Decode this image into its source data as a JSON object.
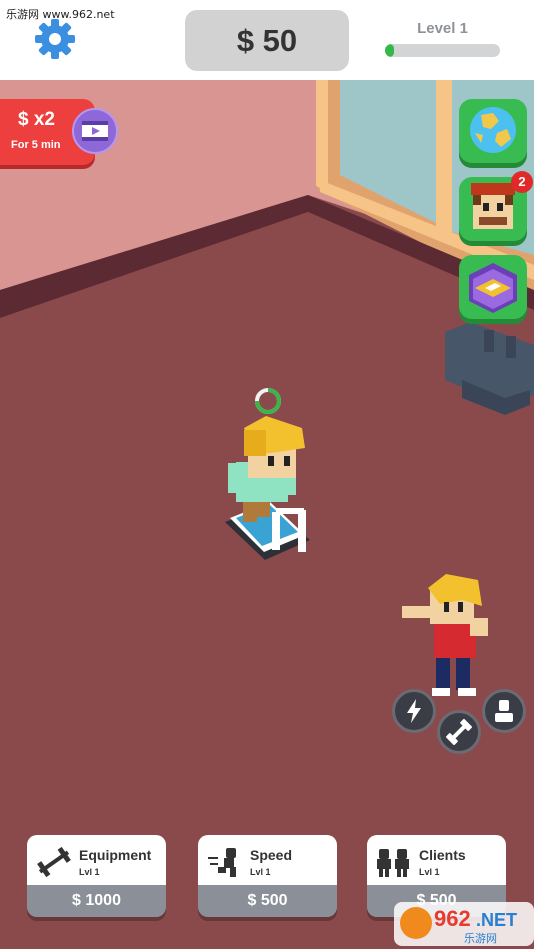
{
  "watermark": "乐游网 www.962.net",
  "top": {
    "money": "$ 50",
    "level_label": "Level 1",
    "level_progress": 0.08
  },
  "boost": {
    "multiplier": "$ x2",
    "duration": "For 5 min"
  },
  "side_buttons": [
    {
      "name": "world",
      "icon": "globe-icon"
    },
    {
      "name": "staff",
      "icon": "trainer-face-icon",
      "badge": "2"
    },
    {
      "name": "room",
      "icon": "room-cube-icon"
    }
  ],
  "action_buttons": [
    "lightning-icon",
    "dumbbell-icon",
    "person-icon"
  ],
  "upgrades": [
    {
      "name": "Equipment",
      "level": "Lvl 1",
      "price": "$ 1000",
      "icon": "barbell-icon"
    },
    {
      "name": "Speed",
      "level": "Lvl 1",
      "price": "$ 500",
      "icon": "runner-icon"
    },
    {
      "name": "Clients",
      "level": "Lvl 1",
      "price": "$ 500",
      "icon": "clients-icon"
    }
  ],
  "logo": {
    "text_main": "962",
    "text_net": ".NET",
    "text_sub": "乐游网"
  },
  "colors": {
    "floor": "#8a4a4c",
    "wall": "#d99592",
    "accent_green": "#38bc52",
    "boost_red": "#ee3f3f",
    "progress_green": "#35b84a"
  }
}
